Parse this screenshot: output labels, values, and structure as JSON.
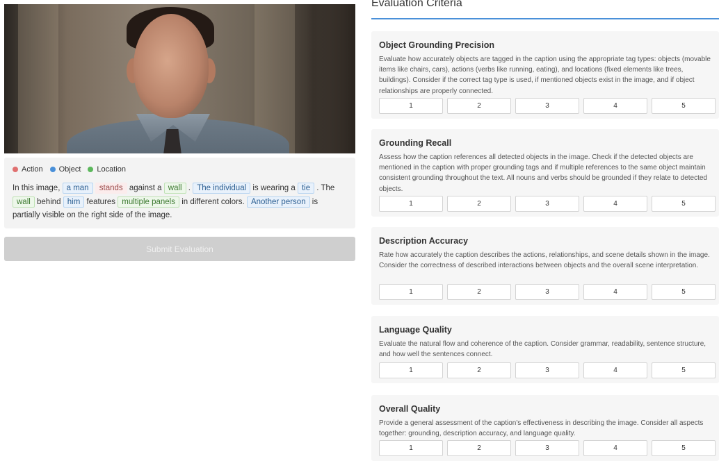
{
  "legend": [
    {
      "label": "Action",
      "color": "#e07070"
    },
    {
      "label": "Object",
      "color": "#4a90d9"
    },
    {
      "label": "Location",
      "color": "#5cb85c"
    }
  ],
  "caption": {
    "t1": "In this image,",
    "a_man": "a man",
    "stands": "stands",
    "t2": "against a",
    "wall1": "wall",
    "t3": ".",
    "the_individual": "The individual",
    "t4": "is wearing a",
    "tie": "tie",
    "t5": ". The",
    "wall2": "wall",
    "t6": "behind",
    "him": "him",
    "t7": "features",
    "multiple_panels": "multiple panels",
    "t8": "in different colors.",
    "another_person": "Another person",
    "t9": "is partially visible on the right side of the image."
  },
  "submit_label": "Submit Evaluation",
  "evaluation": {
    "title": "Evaluation Criteria",
    "scale": [
      "1",
      "2",
      "3",
      "4",
      "5"
    ],
    "criteria": [
      {
        "name": "Object Grounding Precision",
        "description": "Evaluate how accurately objects are tagged in the caption using the appropriate tag types: objects (movable items like chairs, cars), actions (verbs like running, eating), and locations (fixed elements like trees, buildings). Consider if the correct tag type is used, if mentioned objects exist in the image, and if object relationships are properly connected."
      },
      {
        "name": "Grounding Recall",
        "description": "Assess how the caption references all detected objects in the image. Check if the detected objects are mentioned in the caption with proper grounding tags and if multiple references to the same object maintain consistent grounding throughout the text. All nouns and verbs should be grounded if they relate to detected objects."
      },
      {
        "name": "Description Accuracy",
        "description": "Rate how accurately the caption describes the actions, relationships, and scene details shown in the image. Consider the correctness of described interactions between objects and the overall scene interpretation."
      },
      {
        "name": "Language Quality",
        "description": "Evaluate the natural flow and coherence of the caption. Consider grammar, readability, sentence structure, and how well the sentences connect."
      },
      {
        "name": "Overall Quality",
        "description": "Provide a general assessment of the caption's effectiveness in describing the image. Consider all aspects together: grounding, description accuracy, and language quality."
      }
    ]
  }
}
